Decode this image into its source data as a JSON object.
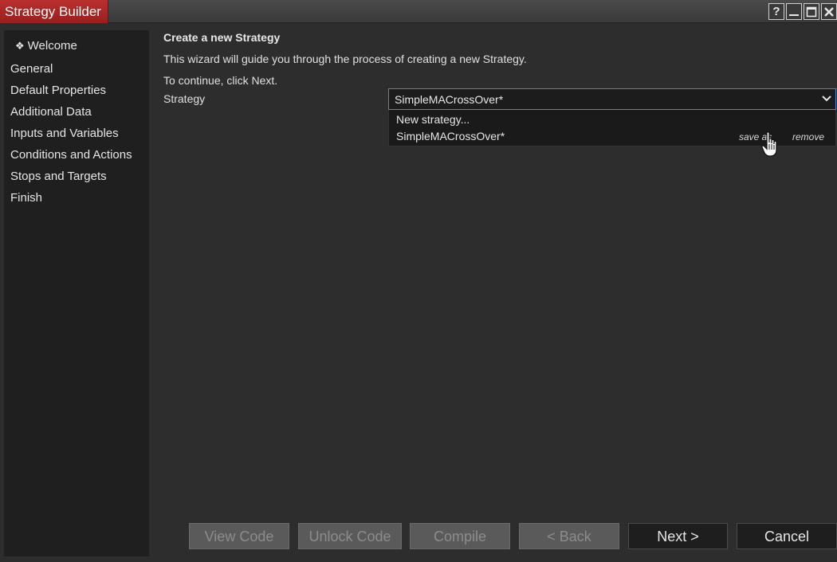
{
  "window": {
    "title": "Strategy Builder",
    "buttons": {
      "help_label": "?"
    }
  },
  "sidebar": {
    "items": [
      {
        "label": "Welcome",
        "current": true
      },
      {
        "label": "General"
      },
      {
        "label": "Default Properties"
      },
      {
        "label": "Additional Data"
      },
      {
        "label": "Inputs and Variables"
      },
      {
        "label": "Conditions and Actions"
      },
      {
        "label": "Stops and Targets"
      },
      {
        "label": "Finish"
      }
    ],
    "current_marker": "❖"
  },
  "main": {
    "title": "Create a new Strategy",
    "description": "This wizard will guide you through the process of creating a new Strategy.",
    "continue_text": "To continue, click Next.",
    "strategy_label": "Strategy",
    "strategy_select": {
      "value": "SimpleMACrossOver*"
    },
    "dropdown": {
      "items": [
        {
          "label": "New strategy..."
        },
        {
          "label": "SimpleMACrossOver*"
        }
      ],
      "save_as_label": "save as",
      "remove_label": "remove"
    }
  },
  "footer": {
    "view_code": "View Code",
    "unlock_code": "Unlock Code",
    "compile": "Compile",
    "back": "< Back",
    "next": "Next >",
    "cancel": "Cancel"
  },
  "colors": {
    "title_tab": "#a8282a",
    "select_border": "#4b86c8",
    "background": "#2d2d2d",
    "sidebar": "#1f1f1f"
  }
}
